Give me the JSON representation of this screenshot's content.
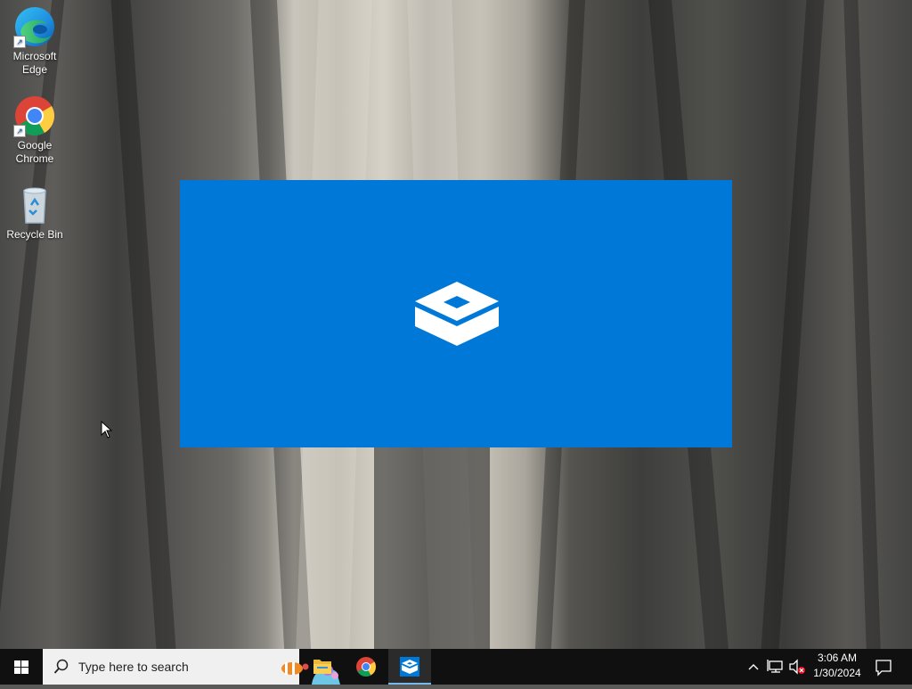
{
  "desktop": {
    "icons": [
      {
        "label": "Microsoft Edge",
        "icon": "edge-icon"
      },
      {
        "label": "Google Chrome",
        "icon": "chrome-icon"
      },
      {
        "label": "Recycle Bin",
        "icon": "recycle-bin-icon"
      }
    ]
  },
  "splash": {
    "background": "#0078d7",
    "logo": "sandbox-box-icon"
  },
  "taskbar": {
    "search_placeholder": "Type here to search",
    "apps": [
      {
        "name": "File Explorer",
        "icon": "folder-icon",
        "active": false
      },
      {
        "name": "Google Chrome",
        "icon": "chrome-icon",
        "active": false
      },
      {
        "name": "Windows Sandbox",
        "icon": "sandbox-box-icon",
        "active": true
      }
    ],
    "tray": {
      "chevron": "chevron-up-icon",
      "network": "network-icon",
      "volume": "volume-muted-icon"
    },
    "clock": {
      "time": "3:06 AM",
      "date": "1/30/2024"
    },
    "notification": "action-center-icon"
  },
  "colors": {
    "accent": "#0078d7",
    "taskbar": "#101010",
    "active_indicator": "#76b9ed"
  }
}
